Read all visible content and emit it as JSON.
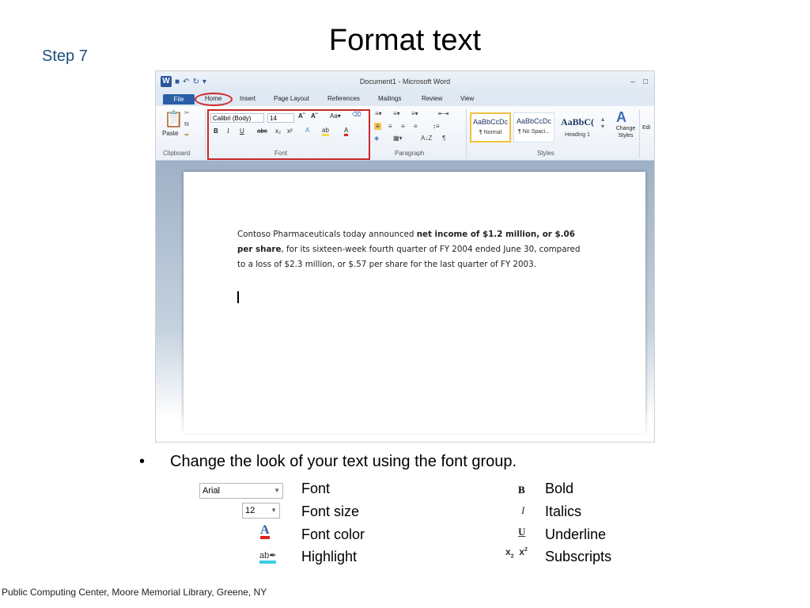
{
  "slide": {
    "step": "Step 7",
    "title": "Format text",
    "bullet": "Change the look of your text using the font group.",
    "footer": "Public Computing Center,  Moore Memorial Library, Greene, NY"
  },
  "word": {
    "window_title": "Document1  -  Microsoft Word",
    "tabs": [
      "File",
      "Home",
      "Insert",
      "Page Layout",
      "References",
      "Mailings",
      "Review",
      "View"
    ],
    "groups": {
      "clipboard": "Clipboard",
      "font": "Font",
      "paragraph": "Paragraph",
      "styles": "Styles"
    },
    "paste_label": "Paste",
    "font_name": "Calibri (Body)",
    "font_size": "14",
    "styles": [
      {
        "sample": "AaBbCcDc",
        "name": "¶ Normal"
      },
      {
        "sample": "AaBbCcDc",
        "name": "¶ No Spaci..."
      },
      {
        "sample": "AaBbC(",
        "name": "Heading 1"
      }
    ],
    "change_styles": "Change Styles",
    "editing_label": "Edi",
    "document": {
      "t1": "Contoso Pharmaceuticals today announced ",
      "b1": "net income of $1.2 million, or $.06 per share",
      "t2": ", for its sixteen-week fourth quarter of FY 2004 ended June 30, compared to a loss of $2.3 million, or $.57 per share for the last quarter of FY 2003."
    }
  },
  "legend": {
    "font_sample": "Arial",
    "size_sample": "12",
    "font": "Font",
    "font_size": "Font size",
    "font_color": "Font  color",
    "highlight": "Highlight",
    "bold": "Bold",
    "italics": "Italics",
    "underline": "Underline",
    "subscripts": "Subscripts"
  }
}
